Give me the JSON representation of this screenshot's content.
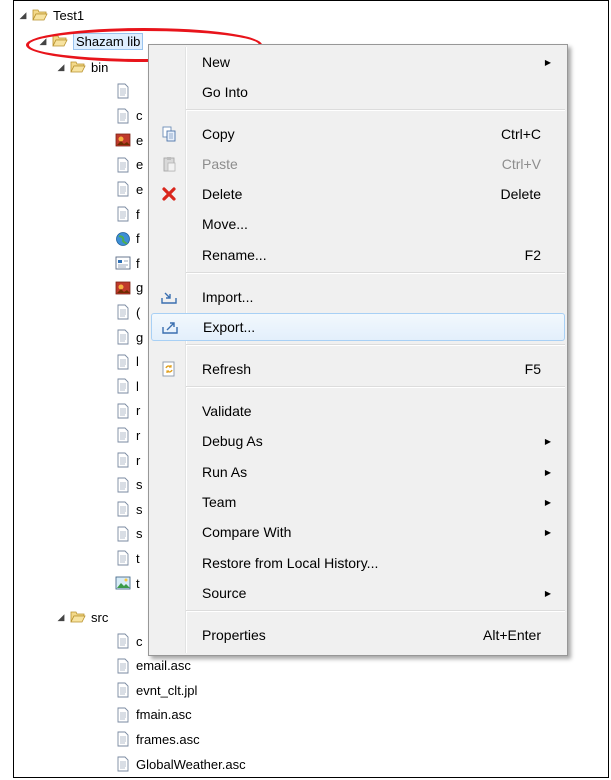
{
  "tree": {
    "project": "Test1",
    "folder_lib": "Shazam lib",
    "folder_bin": "bin",
    "folder_src": "src",
    "bin_files": [
      {
        "icon": "file-icon",
        "label": ""
      },
      {
        "icon": "file-icon",
        "label": "c"
      },
      {
        "icon": "image-icon",
        "label": "e"
      },
      {
        "icon": "file-icon",
        "label": "e"
      },
      {
        "icon": "file-icon",
        "label": "e"
      },
      {
        "icon": "file-icon",
        "label": "f"
      },
      {
        "icon": "globe-icon",
        "label": "f"
      },
      {
        "icon": "form-icon",
        "label": "f"
      },
      {
        "icon": "image-icon",
        "label": "g"
      },
      {
        "icon": "file-icon",
        "label": "("
      },
      {
        "icon": "file-icon",
        "label": "g"
      },
      {
        "icon": "file-icon",
        "label": "l"
      },
      {
        "icon": "file-icon",
        "label": "l"
      },
      {
        "icon": "file-icon",
        "label": "r"
      },
      {
        "icon": "file-icon",
        "label": "r"
      },
      {
        "icon": "file-icon",
        "label": "r"
      },
      {
        "icon": "file-icon",
        "label": "s"
      },
      {
        "icon": "file-icon",
        "label": "s"
      },
      {
        "icon": "file-icon",
        "label": "s"
      },
      {
        "icon": "file-icon",
        "label": "t"
      },
      {
        "icon": "picture-icon",
        "label": "t"
      }
    ],
    "src_files": [
      {
        "icon": "file-icon",
        "label": "c"
      },
      {
        "icon": "file-icon",
        "label": "email.asc"
      },
      {
        "icon": "file-icon",
        "label": "evnt_clt.jpl"
      },
      {
        "icon": "file-icon",
        "label": "fmain.asc"
      },
      {
        "icon": "file-icon",
        "label": "frames.asc"
      },
      {
        "icon": "file-icon",
        "label": "GlobalWeather.asc"
      }
    ]
  },
  "menu": {
    "items": [
      {
        "label": "New",
        "shortcut": "",
        "submenu": true,
        "icon": ""
      },
      {
        "label": "Go Into",
        "shortcut": "",
        "submenu": false,
        "icon": ""
      },
      {
        "label": "Copy",
        "shortcut": "Ctrl+C",
        "submenu": false,
        "icon": "copy-icon"
      },
      {
        "label": "Paste",
        "shortcut": "Ctrl+V",
        "submenu": false,
        "icon": "paste-icon",
        "disabled": true
      },
      {
        "label": "Delete",
        "shortcut": "Delete",
        "submenu": false,
        "icon": "delete-icon"
      },
      {
        "label": "Move...",
        "shortcut": "",
        "submenu": false,
        "icon": ""
      },
      {
        "label": "Rename...",
        "shortcut": "F2",
        "submenu": false,
        "icon": ""
      },
      {
        "label": "Import...",
        "shortcut": "",
        "submenu": false,
        "icon": "import-icon"
      },
      {
        "label": "Export...",
        "shortcut": "",
        "submenu": false,
        "icon": "export-icon",
        "highlighted": true
      },
      {
        "label": "Refresh",
        "shortcut": "F5",
        "submenu": false,
        "icon": "refresh-icon"
      },
      {
        "label": "Validate",
        "shortcut": "",
        "submenu": false,
        "icon": ""
      },
      {
        "label": "Debug As",
        "shortcut": "",
        "submenu": true,
        "icon": ""
      },
      {
        "label": "Run As",
        "shortcut": "",
        "submenu": true,
        "icon": ""
      },
      {
        "label": "Team",
        "shortcut": "",
        "submenu": true,
        "icon": ""
      },
      {
        "label": "Compare With",
        "shortcut": "",
        "submenu": true,
        "icon": ""
      },
      {
        "label": "Restore from Local History...",
        "shortcut": "",
        "submenu": false,
        "icon": ""
      },
      {
        "label": "Source",
        "shortcut": "",
        "submenu": true,
        "icon": ""
      },
      {
        "label": "Properties",
        "shortcut": "Alt+Enter",
        "submenu": false,
        "icon": ""
      }
    ]
  },
  "colors": {
    "annotation_ellipse": "#e8141b",
    "highlight": "#e3effb",
    "folder": "#e9c55a"
  }
}
